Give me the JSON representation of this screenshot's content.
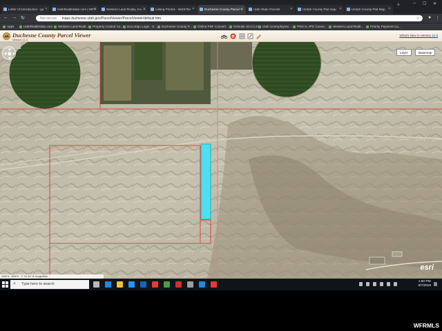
{
  "browser": {
    "tabs": [
      {
        "label": "Letter of Introduction - go"
      },
      {
        "label": "UtahRealEstate.com | WFR"
      },
      {
        "label": "Western Land Realty, Inc. A"
      },
      {
        "label": "Listing Photos - 6626752"
      },
      {
        "label": "Duchesne County Parcel V"
      },
      {
        "label": "Utah State Parcels"
      },
      {
        "label": "Uintah County Plat map"
      },
      {
        "label": "Uintah County Plat Map"
      }
    ],
    "active_tab": 4,
    "address": {
      "security": "Not secure",
      "url": "maps.duchesne.utah.gov/ParcelViewer/ParcelViewer/default.htm"
    },
    "bookmarks": [
      {
        "label": "Apps"
      },
      {
        "label": "UtahRealEstate.com"
      },
      {
        "label": "Western Land Realt..."
      },
      {
        "label": "Property Control Ce..."
      },
      {
        "label": "DocuSign Login - E..."
      },
      {
        "label": "Duchesne County P..."
      },
      {
        "label": "Online PDF Convert..."
      },
      {
        "label": "OnSuite 10.0.0.23"
      },
      {
        "label": "Utah Unemployme..."
      },
      {
        "label": "PNG to JPG Conve..."
      },
      {
        "label": "Western Land Realt..."
      },
      {
        "label": "Priority Payment Ca..."
      }
    ]
  },
  "app": {
    "title": "Duchesne County Parcel Viewer",
    "version": "Version 11.0",
    "whats_new": "What's New in Version 11.0",
    "tool_icons": [
      "bicycle-icon",
      "record-icon",
      "list-icon",
      "edit-icon",
      "pencil-icon"
    ]
  },
  "map": {
    "buttons": {
      "layer": "Layer",
      "basemap": "Basemap"
    },
    "scale_text": "1000 ft · 4000 ft · 1° 34' 40\" N   Google/Esri",
    "attribution": "esri"
  },
  "taskbar": {
    "search_placeholder": "Type here to search",
    "time": "1:50 PM",
    "date": "3/7/2019"
  },
  "watermark": "WFRMLS",
  "colors": {
    "parcel_line": "#e0262b",
    "selected_parcel": "#4ee0f0",
    "header_title": "#6b3a1e"
  }
}
